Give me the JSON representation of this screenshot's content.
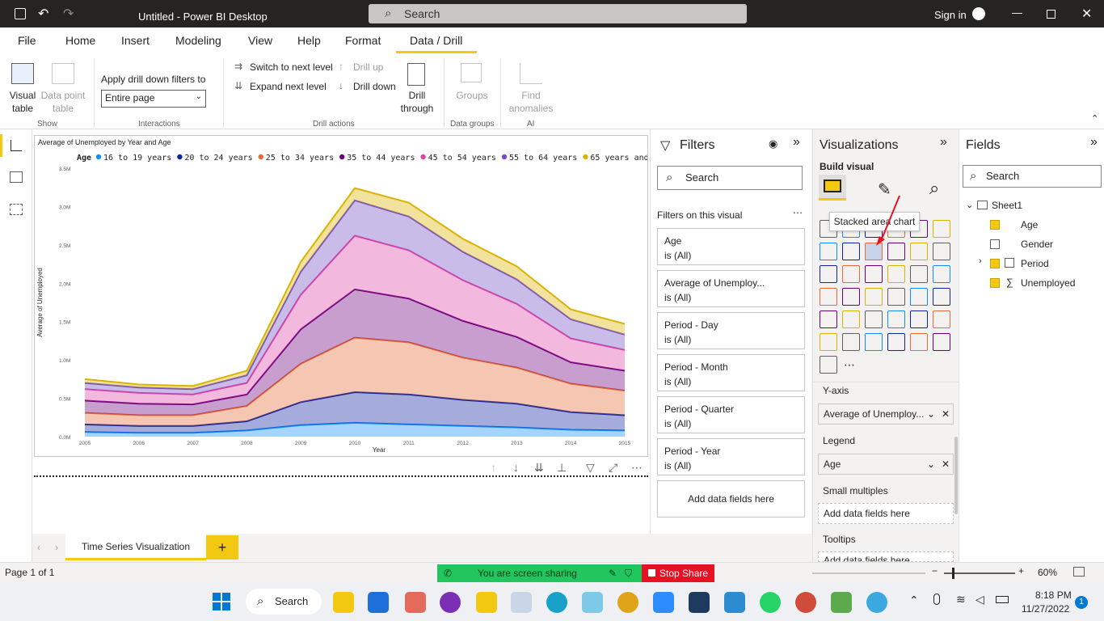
{
  "window": {
    "title": "Untitled - Power BI Desktop",
    "search_placeholder": "Search",
    "sign_in": "Sign in"
  },
  "ribbon_tabs": [
    "File",
    "Home",
    "Insert",
    "Modeling",
    "View",
    "Help",
    "Format",
    "Data / Drill"
  ],
  "ribbon": {
    "visual_table": "Visual table",
    "data_point_table": "Data point table",
    "show_group": "Show",
    "apply_drill_label": "Apply drill down filters to",
    "apply_drill_value": "Entire page",
    "interactions_group": "Interactions",
    "switch_next_level": "Switch to next level",
    "expand_next_level": "Expand next level",
    "drill_up": "Drill up",
    "drill_down": "Drill down",
    "drill_through": "Drill through",
    "drill_actions_group": "Drill actions",
    "groups": "Groups",
    "data_groups_group": "Data groups",
    "find_anomalies": "Find anomalies",
    "ai_group": "AI"
  },
  "chart_data": {
    "type": "area",
    "title": "Average of Unemployed by Year and Age",
    "xlabel": "Year",
    "ylabel": "Average of Unemployed",
    "legend_title": "Age",
    "legend_position": "top",
    "stacked": true,
    "ylim": [
      0,
      3500000
    ],
    "y_ticks": [
      "0.0M",
      "0.5M",
      "1.0M",
      "1.5M",
      "2.0M",
      "2.5M",
      "3.0M",
      "3.5M"
    ],
    "categories": [
      "2005",
      "2006",
      "2007",
      "2008",
      "2009",
      "2010",
      "2011",
      "2012",
      "2013",
      "2014",
      "2015"
    ],
    "series": [
      {
        "name": "16 to 19 years",
        "color": "#118dff",
        "values": [
          60000,
          50000,
          50000,
          80000,
          150000,
          180000,
          160000,
          140000,
          120000,
          90000,
          80000
        ]
      },
      {
        "name": "20 to 24 years",
        "color": "#12239e",
        "values": [
          100000,
          90000,
          90000,
          120000,
          300000,
          400000,
          390000,
          340000,
          310000,
          230000,
          200000
        ]
      },
      {
        "name": "25 to 34 years",
        "color": "#e66c37",
        "values": [
          150000,
          140000,
          140000,
          200000,
          500000,
          710000,
          680000,
          550000,
          470000,
          370000,
          320000
        ]
      },
      {
        "name": "35 to 44 years",
        "color": "#6b007b",
        "values": [
          160000,
          150000,
          140000,
          150000,
          450000,
          630000,
          570000,
          480000,
          400000,
          280000,
          260000
        ]
      },
      {
        "name": "45 to 54 years",
        "color": "#e044a7",
        "values": [
          150000,
          140000,
          130000,
          150000,
          450000,
          700000,
          630000,
          530000,
          430000,
          310000,
          270000
        ]
      },
      {
        "name": "55 to 64 years",
        "color": "#744ec2",
        "values": [
          80000,
          70000,
          70000,
          100000,
          300000,
          460000,
          440000,
          370000,
          320000,
          250000,
          200000
        ]
      },
      {
        "name": "65 years and over",
        "color": "#d9b300",
        "values": [
          50000,
          40000,
          40000,
          60000,
          130000,
          160000,
          180000,
          170000,
          170000,
          130000,
          140000
        ]
      }
    ]
  },
  "filters": {
    "title": "Filters",
    "search_placeholder": "Search",
    "section": "Filters on this visual",
    "cards": [
      {
        "name": "Age",
        "state": "is (All)"
      },
      {
        "name": "Average of Unemploy...",
        "state": "is (All)"
      },
      {
        "name": "Period - Day",
        "state": "is (All)"
      },
      {
        "name": "Period - Month",
        "state": "is (All)"
      },
      {
        "name": "Period - Quarter",
        "state": "is (All)"
      },
      {
        "name": "Period - Year",
        "state": "is (All)"
      }
    ],
    "add_fields": "Add data fields here"
  },
  "visualizations": {
    "title": "Visualizations",
    "build_visual": "Build visual",
    "tooltip": "Stacked area chart",
    "y_axis_label": "Y-axis",
    "y_axis_value": "Average of Unemploy...",
    "legend_label": "Legend",
    "legend_value": "Age",
    "small_multiples_label": "Small multiples",
    "small_multiples_placeholder": "Add data fields here",
    "tooltips_label": "Tooltips",
    "tooltips_placeholder": "Add data fields here"
  },
  "fields": {
    "title": "Fields",
    "search_placeholder": "Search",
    "table": "Sheet1",
    "items": [
      {
        "label": "Age",
        "checked": true
      },
      {
        "label": "Gender",
        "checked": false
      },
      {
        "label": "Period",
        "checked": true
      },
      {
        "label": "Unemployed",
        "checked": true
      }
    ]
  },
  "page_tab": "Time Series Visualization",
  "status": {
    "page": "Page 1 of 1",
    "zoom": "60%"
  },
  "screen_share": {
    "text": "You are screen sharing",
    "stop": "Stop Share"
  },
  "taskbar": {
    "search": "Search",
    "time": "8:18 PM",
    "date": "11/27/2022",
    "notif": "1"
  }
}
